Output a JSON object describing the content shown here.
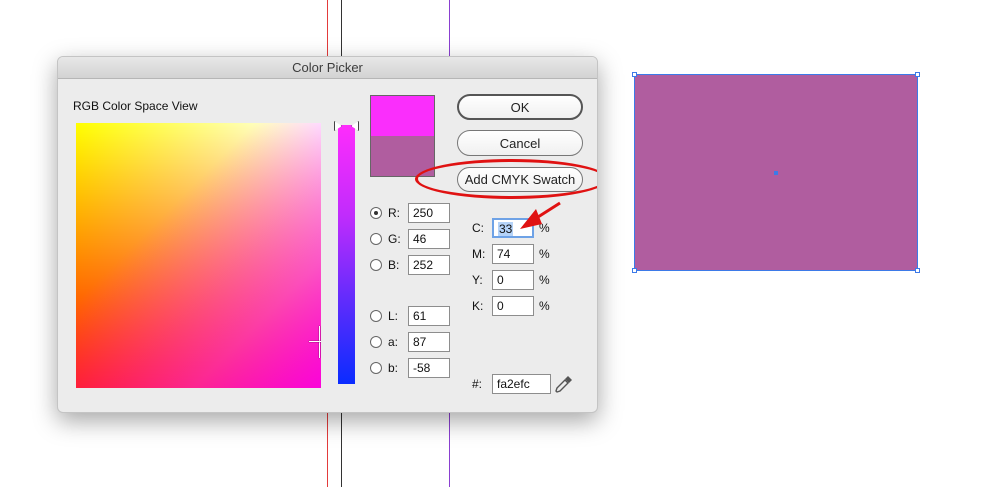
{
  "dialog": {
    "title": "Color Picker",
    "space_label": "RGB Color Space View",
    "buttons": {
      "ok": "OK",
      "cancel": "Cancel",
      "add_swatch": "Add CMYK Swatch"
    },
    "rgb": [
      {
        "label": "R:",
        "value": "250",
        "selected": true
      },
      {
        "label": "G:",
        "value": "46",
        "selected": false
      },
      {
        "label": "B:",
        "value": "252",
        "selected": false
      }
    ],
    "lab": [
      {
        "label": "L:",
        "value": "61"
      },
      {
        "label": "a:",
        "value": "87"
      },
      {
        "label": "b:",
        "value": "-58"
      }
    ],
    "cmyk": [
      {
        "label": "C:",
        "value": "33",
        "unit": "%"
      },
      {
        "label": "M:",
        "value": "74",
        "unit": "%"
      },
      {
        "label": "Y:",
        "value": "0",
        "unit": "%"
      },
      {
        "label": "K:",
        "value": "0",
        "unit": "%"
      }
    ],
    "hex": {
      "label": "#:",
      "value": "fa2efc"
    },
    "colors": {
      "new_color": "#fa2efc",
      "original_color": "#b05d9f"
    }
  },
  "canvas": {
    "rect_fill": "#b05d9f",
    "selection_color": "#3d7ae8"
  },
  "annotations": {
    "highlight_color": "#e01212"
  },
  "icons": [
    "eyedropper-icon",
    "slider-knob-icon",
    "crosshair-icon"
  ]
}
